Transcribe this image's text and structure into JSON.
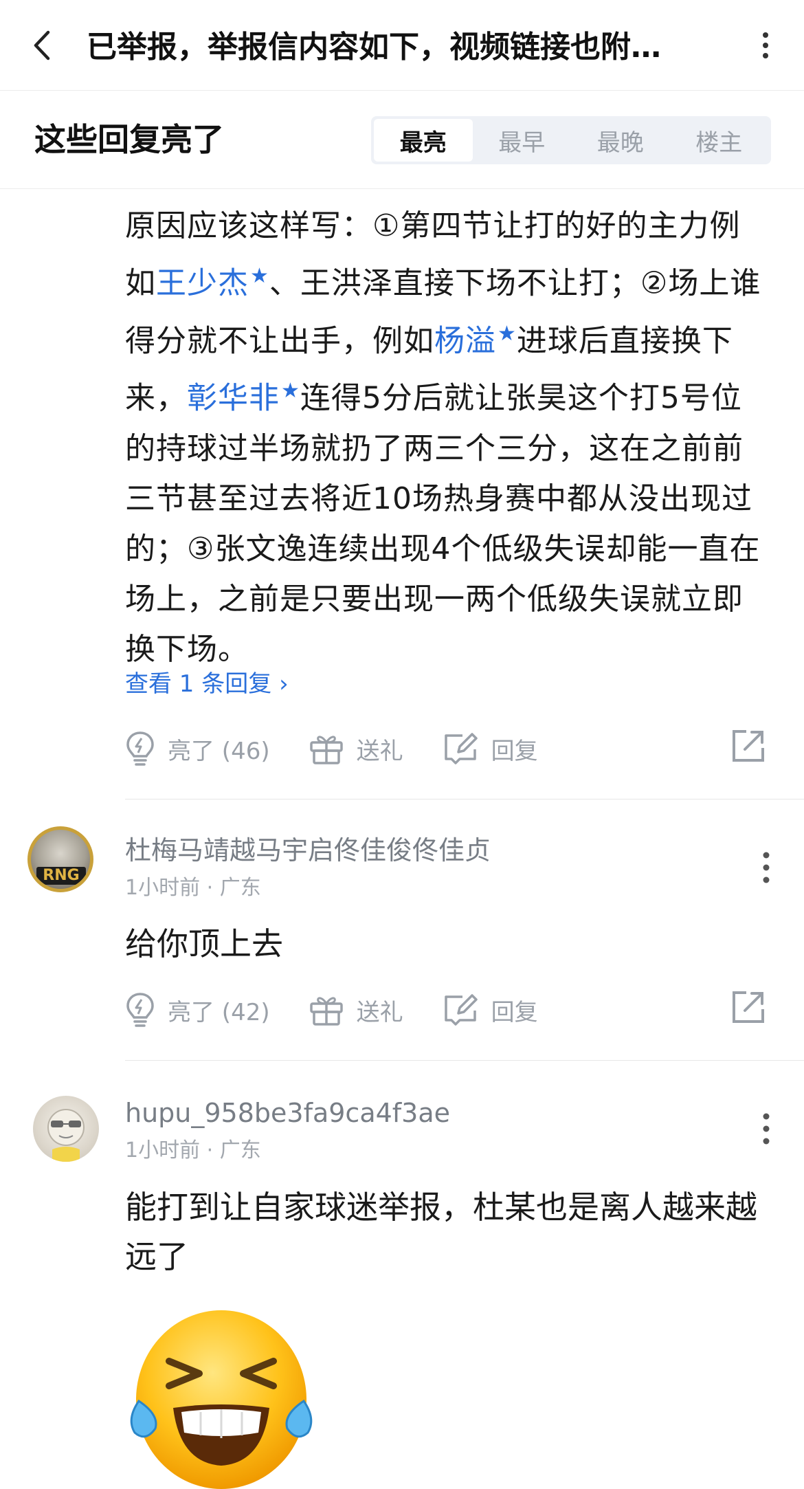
{
  "header": {
    "title": "已举报，举报信内容如下，视频链接也附…"
  },
  "section": {
    "title": "这些回复亮了",
    "tabs": [
      {
        "label": "最亮",
        "active": true
      },
      {
        "label": "最早",
        "active": false
      },
      {
        "label": "最晚",
        "active": false
      },
      {
        "label": "楼主",
        "active": false
      }
    ]
  },
  "comment1": {
    "segments": {
      "s1": "原因应该这样写：①第四节让打的好的主力例如",
      "m1": "王少杰",
      "s2": "、王洪泽直接下场不让打；②场上谁得分就不让出手，例如",
      "m2": "杨溢",
      "s3": "进球后直接换下来，",
      "m3": "彰华非",
      "s4": "连得5分后就让张昊这个打5号位的持球过半场就扔了两三个三分，这在之前前三节甚至过去将近10场热身赛中都从没出现过的；③张文逸连续出现4个低级失误却能一直在场上，之前是只要出现一两个低级失误就立即换下场。"
    },
    "view_replies": "查看 1 条回复",
    "actions": {
      "like": "亮了 (46)",
      "gift": "送礼",
      "reply": "回复"
    }
  },
  "comment2": {
    "username": "杜梅马靖越马宇启佟佳俊佟佳贞",
    "meta": "1小时前 · 广东",
    "avatar_badge": "RNG",
    "text": "给你顶上去",
    "actions": {
      "like": "亮了 (42)",
      "gift": "送礼",
      "reply": "回复"
    }
  },
  "comment3": {
    "username": "hupu_958be3fa9ca4f3ae",
    "meta": "1小时前 · 广东",
    "text": "能打到让自家球迷举报，杜某也是离人越来越远了"
  },
  "colors": {
    "link": "#2a6fdb",
    "muted": "#9aa0a8",
    "tab_bg": "#eef1f6"
  }
}
